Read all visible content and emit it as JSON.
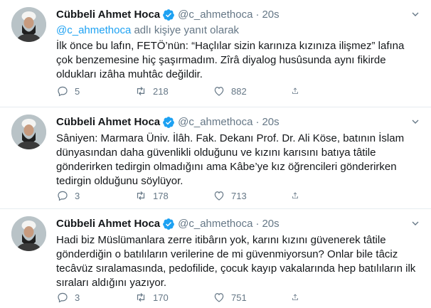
{
  "colors": {
    "accent": "#1da1f2",
    "text": "#14171a",
    "muted": "#657786",
    "divider": "#e6ecf0"
  },
  "tweets": [
    {
      "author": "Cübbeli Ahmet Hoca",
      "handle": "@c_ahmethoca",
      "separator": "·",
      "time": "20s",
      "reply_handle": "@c_ahmethoca",
      "reply_suffix": " adlı kişiye yanıt olarak",
      "text": "İlk önce bu lafın, FETÖ’nün: “Haçlılar sizin karınıza kızınıza ilişmez” lafına çok benzemesine hiç şaşırmadım. Zîrâ diyalog husûsunda aynı fikirde oldukları izâha muhtâc değildir.",
      "replies": "5",
      "retweets": "218",
      "likes": "882"
    },
    {
      "author": "Cübbeli Ahmet Hoca",
      "handle": "@c_ahmethoca",
      "separator": "·",
      "time": "20s",
      "text": "Sâniyen: Marmara Üniv. İlâh. Fak. Dekanı Prof. Dr. Ali Köse, batının İslam dünyasından daha güvenlikli olduğunu ve kızını karısını batıya tâtile gönderirken tedirgin olmadığını ama Kâbe’ye kız öğrencileri gönderirken tedirgin olduğunu söylüyor.",
      "replies": "3",
      "retweets": "178",
      "likes": "713"
    },
    {
      "author": "Cübbeli Ahmet Hoca",
      "handle": "@c_ahmethoca",
      "separator": "·",
      "time": "20s",
      "text": "Hadi biz Müslümanlara zerre itibârın yok, karını kızını güvenerek tâtile gönderdiğin o batılıların verilerine de mi güvenmiyorsun? Onlar bile tâciz tecâvüz sıralamasında, pedofilide, çocuk kayıp vakalarında hep batılıların ilk sıraları aldığını yazıyor.",
      "replies": "3",
      "retweets": "170",
      "likes": "751"
    }
  ]
}
